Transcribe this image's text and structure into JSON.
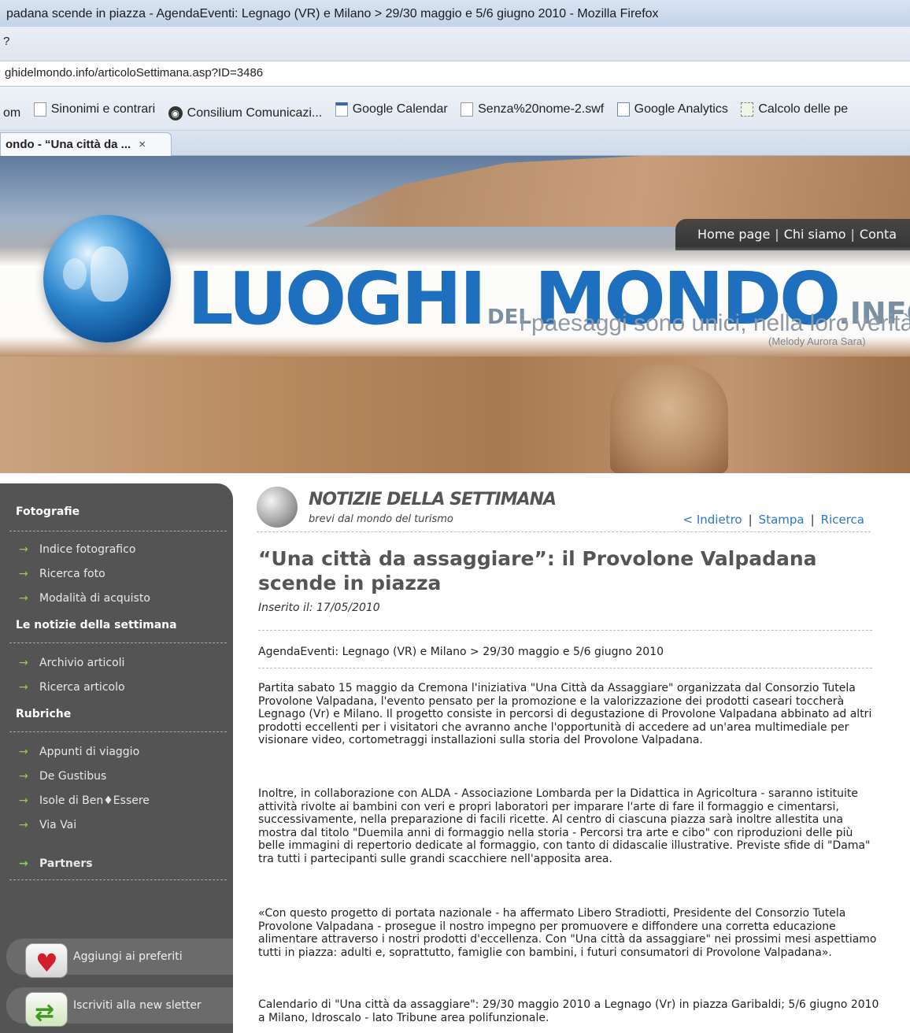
{
  "browser": {
    "window_title": "padana scende in piazza - AgendaEventi: Legnago (VR) e Milano > 29/30 maggio e 5/6 giugno 2010 - Mozilla Firefox",
    "menu_fragment": "?",
    "url": "ghidelmondo.info/articoloSettimana.asp?ID=3486",
    "bookmarks": [
      {
        "label": "om",
        "icon": "none"
      },
      {
        "label": "Sinonimi e contrari",
        "icon": "page-icon"
      },
      {
        "label": "Consilium Comunicazi...",
        "icon": "consilium-icon"
      },
      {
        "label": "Google Calendar",
        "icon": "calendar-icon"
      },
      {
        "label": "Senza%20nome-2.swf",
        "icon": "page-icon"
      },
      {
        "label": "Google Analytics",
        "icon": "analytics-icon"
      },
      {
        "label": "Calcolo delle pe",
        "icon": "calculator-icon"
      }
    ],
    "tab": {
      "label": "ondo - “Una città da ...",
      "close": "×"
    }
  },
  "header": {
    "nav": {
      "home": "Home page",
      "about": "Chi siamo",
      "contact": "Conta",
      "separator": "|"
    },
    "logo": {
      "part1": "LUOGHI",
      "part2": "DEL",
      "part3": "MONDO",
      "part4": ".INFO"
    },
    "tagline": "i paesaggi sono unici, nella loro verità",
    "author": "(Melody Aurora Sara)"
  },
  "sidebar": {
    "sections": [
      {
        "title": "Fotografie",
        "items": [
          "Indice fotografico",
          "Ricerca foto",
          "Modalità di acquisto"
        ]
      },
      {
        "title": "Le notizie della settimana",
        "items": [
          "Archivio articoli",
          "Ricerca articolo"
        ]
      },
      {
        "title": "Rubriche",
        "items": [
          "Appunti di viaggio",
          "De Gustibus",
          "Isole di Ben♦Essere",
          "Via Vai"
        ]
      }
    ],
    "partners": "Partners",
    "buttons": {
      "favorites": "Aggiungi ai preferiti",
      "newsletter": "Iscriviti alla new sletter"
    }
  },
  "news": {
    "title": "NOTIZIE DELLA SETTIMANA",
    "subtitle": "brevi dal mondo del turismo",
    "links": {
      "back": "< Indietro",
      "print": "Stampa",
      "search": "Ricerca",
      "separator": "|"
    }
  },
  "article": {
    "title": "“Una città da assaggiare”: il Provolone Valpadana scende in piazza",
    "date": "Inserito il: 17/05/2010",
    "event": "AgendaEventi: Legnago (VR) e Milano > 29/30 maggio e 5/6 giugno 2010",
    "paragraphs": [
      "Partita sabato 15 maggio da Cremona l'iniziativa \"Una Città da Assaggiare\" organizzata dal Consorzio Tutela Provolone Valpadana, l'evento pensato per la promozione e la valorizzazione dei prodotti caseari toccherà Legnago (Vr) e Milano. Il progetto consiste in percorsi di degustazione di Provolone Valpadana abbinato ad altri prodotti eccellenti per i visitatori che avranno anche l'opportunità di accedere ad un'area multimediale per visionare video, cortometraggi installazioni sulla storia del Provolone Valpadana.",
      "Inoltre, in collaborazione con ALDA - Associazione Lombarda per la Didattica in Agricoltura - saranno istituite attività rivolte ai bambini con veri e propri laboratori per imparare l'arte di fare il formaggio e cimentarsi, successivamente, nella preparazione di facili ricette. Al centro di ciascuna piazza sarà inoltre allestita una mostra dal titolo \"Duemila anni di formaggio nella storia - Percorsi tra arte e cibo\" con riproduzioni delle più belle immagini di repertorio dedicate al formaggio, con tanto di didascalie illustrative. Previste sfide di \"Dama\" tra tutti i partecipanti sulle grandi scacchiere nell'apposita area.",
      "«Con questo progetto di portata nazionale - ha affermato Libero Stradiotti,  Presidente del Consorzio Tutela Provolone Valpadana - prosegue il nostro impegno per promuovere e diffondere una corretta educazione alimentare attraverso i nostri prodotti d'eccellenza. Con \"Una città da assaggiare\" nei prossimi mesi aspettiamo tutti in piazza: adulti e, soprattutto, famiglie con bambini, i futuri consumatori di Provolone Valpadana».",
      "Calendario di \"Una città da assaggiare\": 29/30 maggio 2010 a Legnago (Vr) in piazza Garibaldi; 5/6 giugno 2010 a Milano, Idroscalo - lato Tribune area polifunzionale."
    ]
  }
}
